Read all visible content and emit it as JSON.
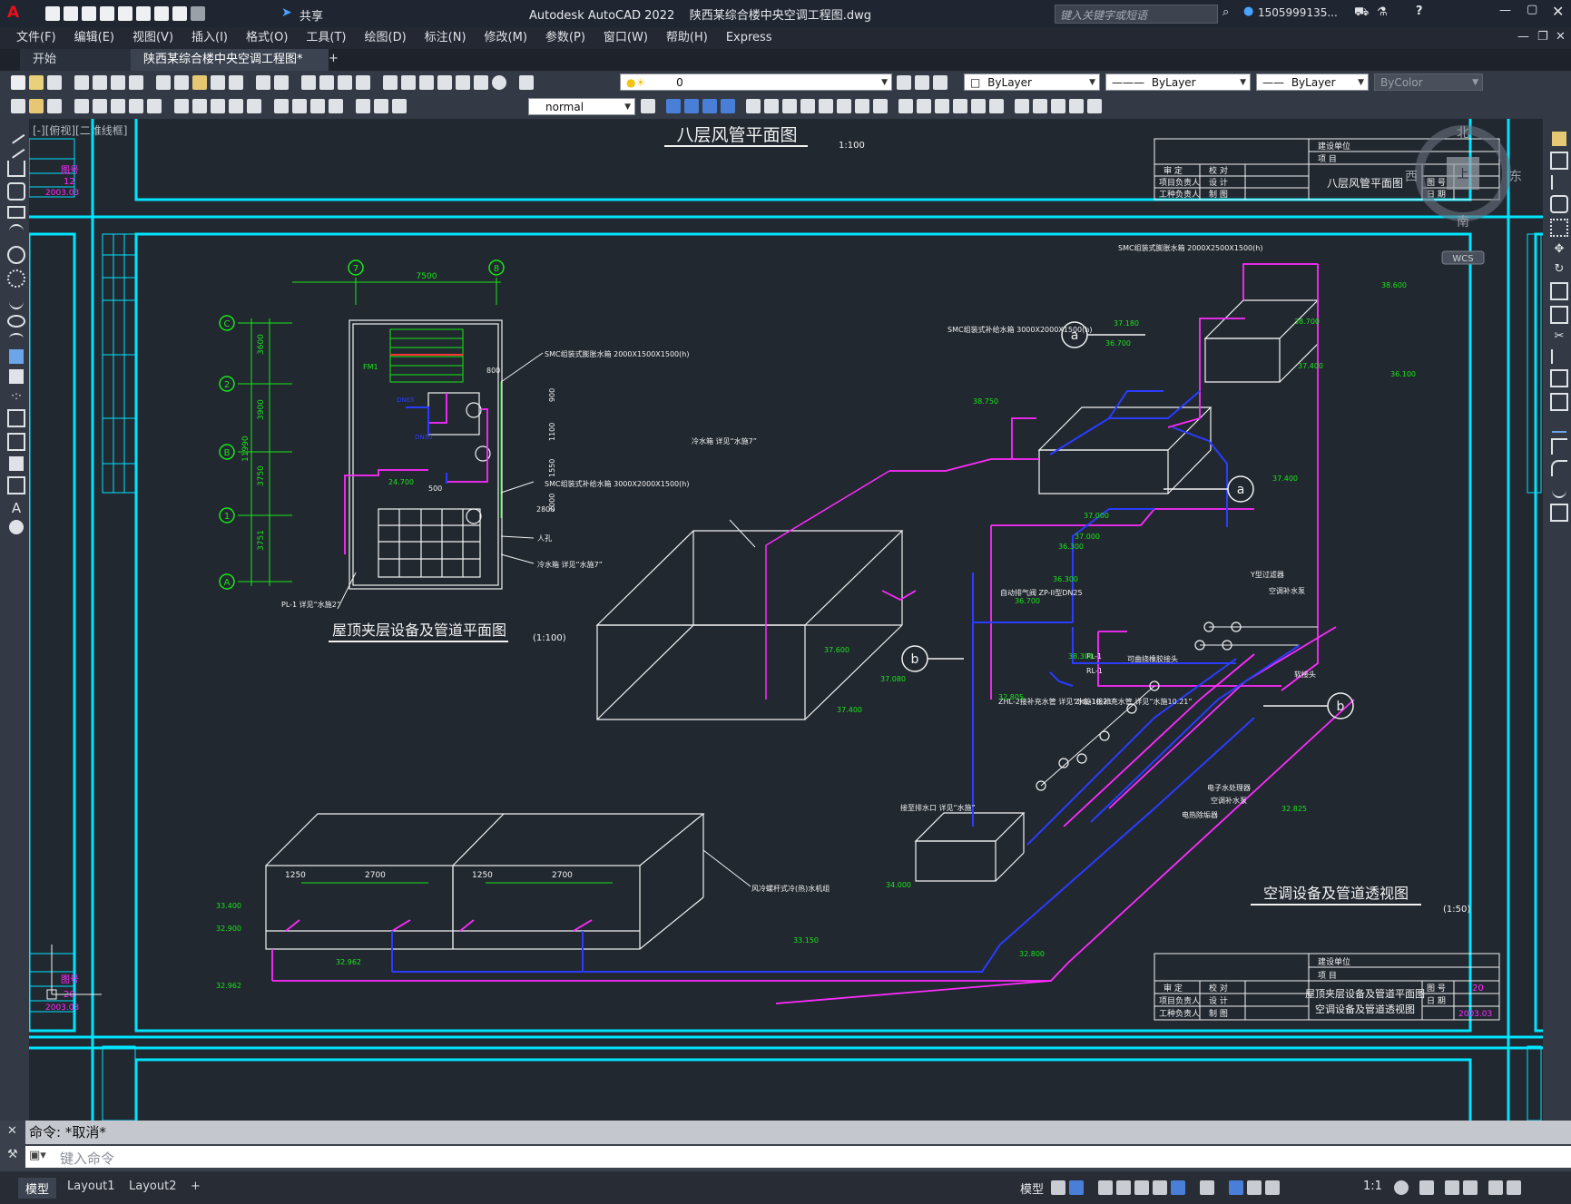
{
  "window": {
    "title": "Autodesk AutoCAD 2022    陕西某综合楼中央空调工程图.dwg",
    "share_label": "共享",
    "search_placeholder": "键入关键字或短语",
    "user": "1505999135...",
    "app_letter": "A"
  },
  "menu": [
    "文件(F)",
    "编辑(E)",
    "视图(V)",
    "插入(I)",
    "格式(O)",
    "工具(T)",
    "绘图(D)",
    "标注(N)",
    "修改(M)",
    "参数(P)",
    "窗口(W)",
    "帮助(H)",
    "Express"
  ],
  "doc_tabs": [
    {
      "label": "开始"
    },
    {
      "label": "陕西某综合楼中央空调工程图*",
      "active": true
    }
  ],
  "toolbar": {
    "layer_value": "0",
    "color_value": "ByLayer",
    "linetype_value": "ByLayer",
    "lineweight_value": "ByLayer",
    "plotstyle_value": "ByColor",
    "textstyle_value": "normal"
  },
  "viewport": {
    "label": "[-][俯视][二维线框]",
    "viewcube": {
      "n": "北",
      "s": "南",
      "e": "东",
      "w": "西",
      "face": "上",
      "wcs": "WCS"
    }
  },
  "drawing": {
    "title_top": "八层风管平面图",
    "title_top_scale": "1:100",
    "title_plan": "屋顶夹层设备及管道平面图",
    "title_plan_scale": "(1:100)",
    "title_iso": "空调设备及管道透视图",
    "title_iso_scale": "(1:50)",
    "axis_labels": [
      "7",
      "8",
      "C",
      "2",
      "B",
      "1",
      "A"
    ],
    "dim_top": "7500",
    "dims_left": [
      "3600",
      "3900",
      "3750",
      "3751",
      "11990"
    ],
    "plan_notes": [
      "SMC组装式膨胀水箱 2000X1500X1500(h)",
      "SMC组装式补给水箱 3000X2000X1500(h)",
      "人孔",
      "冷水箱 详见“水施7”",
      "PL-1 详见“水施2”",
      "FM1",
      "DN65",
      "DN50",
      "24.700",
      "500",
      "800",
      "900",
      "1100",
      "1550",
      "2000",
      "2800"
    ],
    "iso_notes": [
      "SMC组装式膨胀水箱 2000X2500X1500(h)",
      "SMC组装式补给水箱 3000X2000X1500(h)",
      "冷水箱 详见“水施7”",
      "自动排气阀 ZP-II型DN25",
      "PL-1",
      "RL-1",
      "ZHL-2接补充水管 详见“水施10.21”",
      "ZHL-1接补充水管 详见“水施10.21”",
      "Y型过滤器",
      "空调补水泵",
      "软接头",
      "可曲挠橡胶接头",
      "电子水处理器",
      "空调补水泵",
      "电热除垢器",
      "接至排水口 详见“水施”",
      "风冷螺杆式冷(热)水机组"
    ],
    "elevations": [
      "38.600",
      "38.700",
      "37.180",
      "36.700",
      "37.400",
      "38.750",
      "37.000",
      "36.300",
      "37.400",
      "37.000",
      "36.100",
      "36.300",
      "36.700",
      "37.600",
      "37.080",
      "37.400",
      "38.300",
      "32.805",
      "34.000",
      "33.150",
      "32.800",
      "32.825",
      "33.400",
      "32.900",
      "32.962",
      "32.962"
    ],
    "chiller_dims": [
      "1250",
      "2700",
      "1250",
      "2700"
    ],
    "markers": [
      "a",
      "a",
      "b",
      "b"
    ],
    "titleblock_top": {
      "name": "八层风管平面图",
      "rows": [
        "建设单位",
        "项 目",
        "审 定",
        "校 对",
        "项目负责人",
        "设 计",
        "工种负责人",
        "制 图"
      ],
      "sheet_label": "图 号",
      "no_label": "日 期"
    },
    "titleblock_bottom": {
      "name1": "屋顶夹层设备及管道平面图",
      "name2": "空调设备及管道透视图",
      "rows": [
        "建设单位",
        "项 目",
        "审 定",
        "校 对",
        "项目负责人",
        "设 计",
        "工种负责人",
        "制 图"
      ],
      "sheet_label": "图 号",
      "no_label": "日 期",
      "sheet_no": "20",
      "date": "2003.03"
    },
    "left_block_top": {
      "label": "图号",
      "num": "12",
      "date": "2003.03"
    },
    "left_block_bottom": {
      "label": "图号",
      "num": "20",
      "date": "2003.03"
    }
  },
  "command": {
    "history": "命令: *取消*",
    "placeholder": "键入命令"
  },
  "layout_tabs": [
    "模型",
    "Layout1",
    "Layout2"
  ],
  "status": {
    "model_label": "模型",
    "scale": "1:1"
  },
  "colors": {
    "cyan": "#00e5ff",
    "magenta": "#ff2bff",
    "green": "#19e619",
    "blue": "#2b3cff",
    "white": "#f2f2f2"
  }
}
